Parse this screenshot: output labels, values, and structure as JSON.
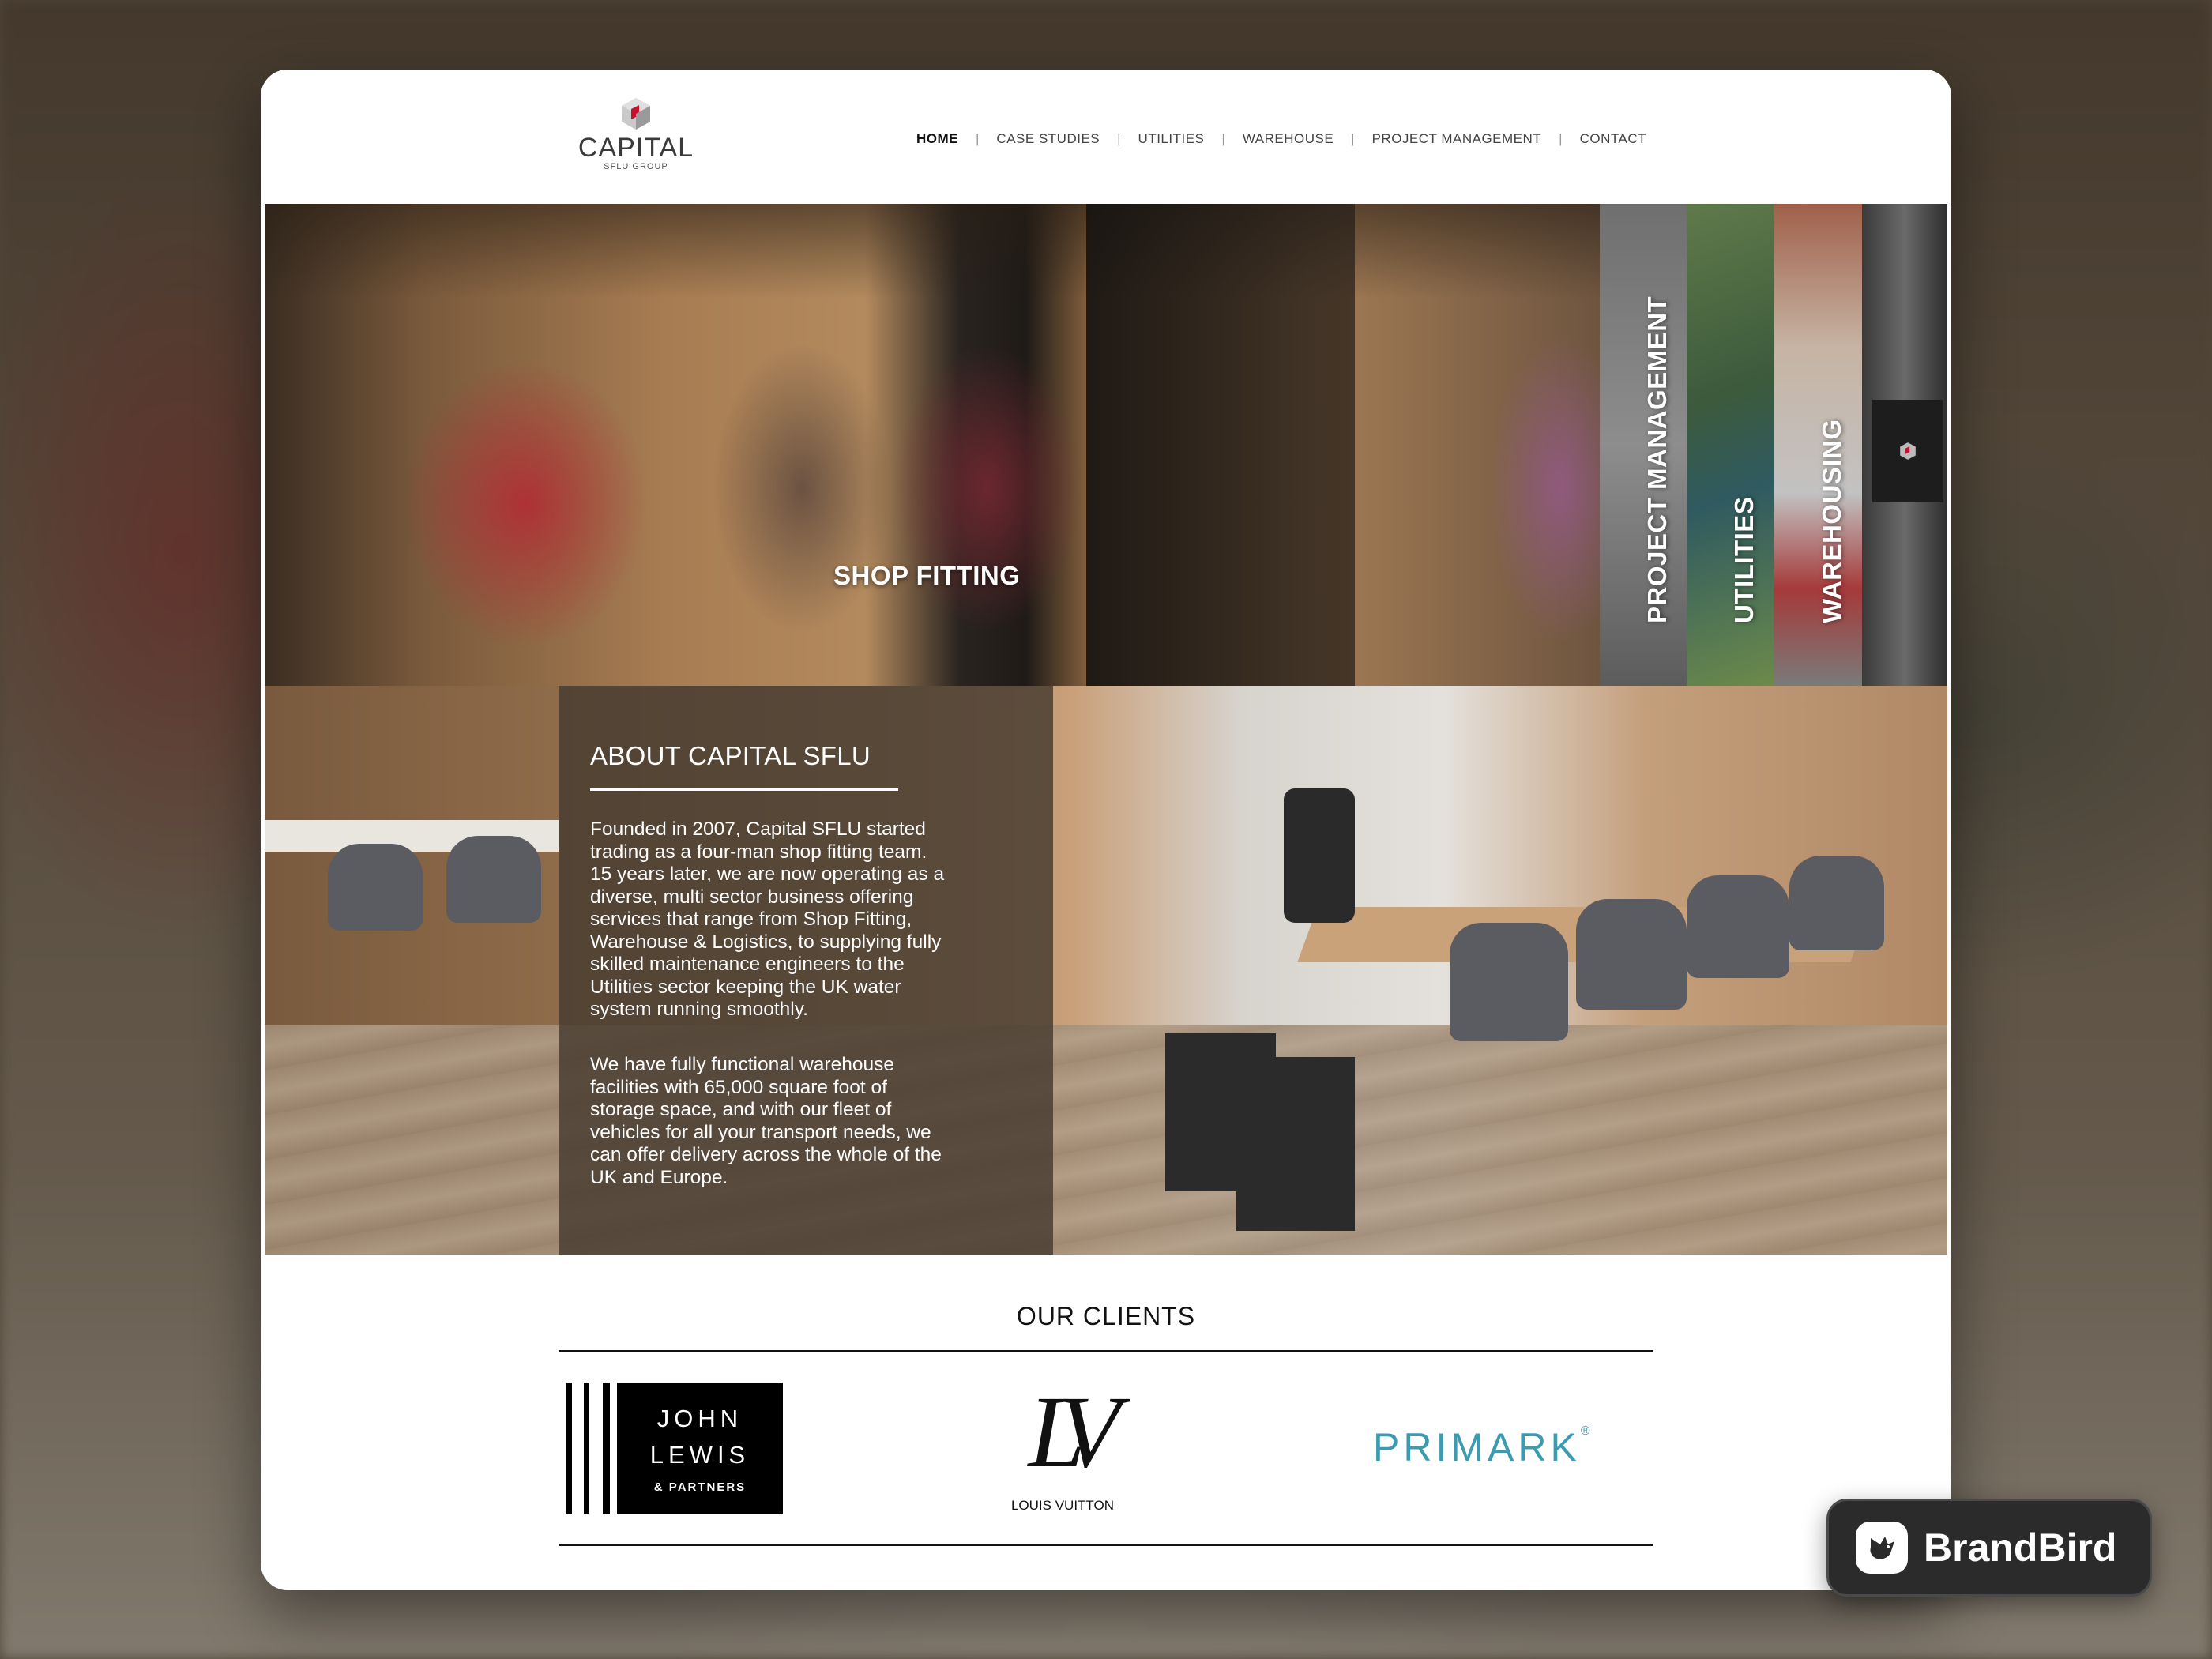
{
  "brand": {
    "name": "CAPITAL",
    "sub": "SFLU GROUP"
  },
  "nav": {
    "items": [
      {
        "label": "HOME",
        "active": true
      },
      {
        "label": "CASE STUDIES"
      },
      {
        "label": "UTILITIES"
      },
      {
        "label": "WAREHOUSE"
      },
      {
        "label": "PROJECT MANAGEMENT"
      },
      {
        "label": "CONTACT"
      }
    ],
    "separator": "|"
  },
  "hero": {
    "main_label": "SHOP FITTING",
    "panels": [
      "PROJECT MANAGEMENT",
      "UTILITIES",
      "WAREHOUSING"
    ]
  },
  "about": {
    "title": "ABOUT CAPITAL SFLU",
    "p1_lines": [
      "Founded in 2007, Capital SFLU started",
      "trading as a four-man shop fitting team.",
      "15 years later, we are now operating as a",
      "diverse, multi sector business offering",
      "services that range from Shop Fitting,",
      "Warehouse & Logistics, to supplying fully",
      "skilled maintenance engineers to the",
      "Utilities sector keeping the UK water",
      "system running smoothly."
    ],
    "p2_lines": [
      "We have fully functional warehouse",
      "facilities with 65,000 square foot of",
      "storage space, and with our fleet of",
      "vehicles for all your transport needs, we",
      "can offer delivery across the whole of the",
      "UK and Europe."
    ]
  },
  "clients": {
    "title": "OUR CLIENTS",
    "john_lewis": {
      "line1": "JOHN",
      "line2": "LEWIS",
      "line3": "& PARTNERS"
    },
    "louis_vuitton": {
      "monogram": "LV",
      "name": "LOUIS VUITTON"
    },
    "primark": {
      "name": "PRIMARK",
      "mark": "®",
      "color": "#3c9bb0"
    }
  },
  "badge": {
    "label": "BrandBird"
  }
}
